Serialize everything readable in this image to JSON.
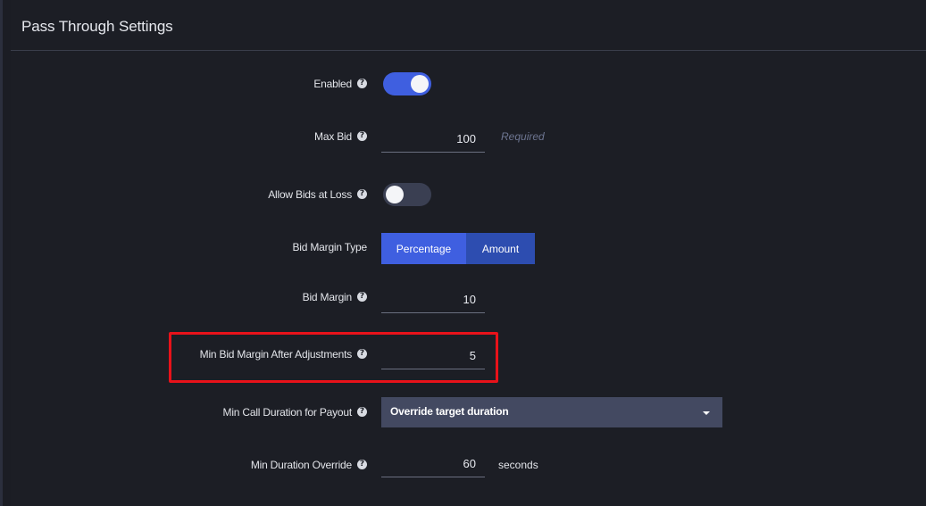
{
  "panel": {
    "title": "Pass Through Settings"
  },
  "fields": {
    "enabled": {
      "label": "Enabled",
      "help_icon": "question-circle-icon",
      "value": "on"
    },
    "max_bid": {
      "label": "Max Bid",
      "help_icon": "question-circle-icon",
      "value": "100",
      "hint": "Required"
    },
    "allow_bids_at_loss": {
      "label": "Allow Bids at Loss",
      "help_icon": "question-circle-icon",
      "value": "off"
    },
    "bid_margin_type": {
      "label": "Bid Margin Type",
      "options": [
        "Percentage",
        "Amount"
      ],
      "selected": "Percentage"
    },
    "bid_margin": {
      "label": "Bid Margin",
      "help_icon": "question-circle-icon",
      "value": "10"
    },
    "min_bid_margin_after_adjustments": {
      "label": "Min Bid Margin After Adjustments",
      "help_icon": "question-circle-icon",
      "value": "5"
    },
    "min_call_duration_for_payout": {
      "label": "Min Call Duration for Payout",
      "help_icon": "question-circle-icon",
      "selected": "Override target duration",
      "caret_icon": "caret-down-icon"
    },
    "min_duration_override": {
      "label": "Min Duration Override",
      "help_icon": "question-circle-icon",
      "value": "60",
      "unit": "seconds"
    }
  },
  "colors": {
    "background": "#1c1e25",
    "accent": "#3f5fe0",
    "highlight": "#e8121a",
    "select_bg": "#434961"
  },
  "help_glyph": "?"
}
